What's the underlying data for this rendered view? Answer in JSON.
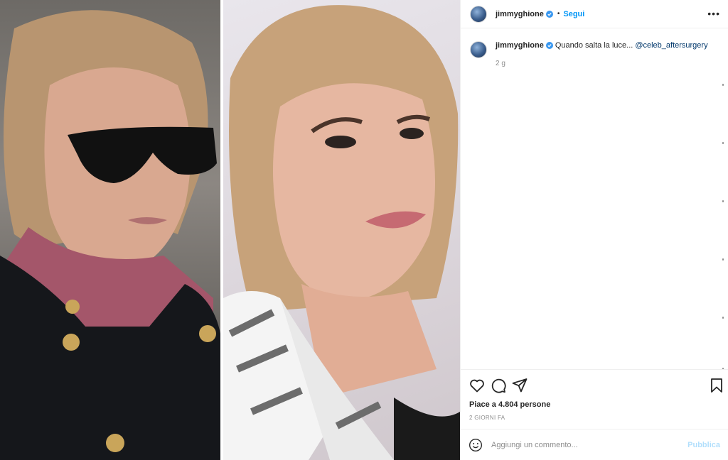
{
  "post": {
    "username": "jimmyghione",
    "follow_label": "Segui",
    "more_label": "•••",
    "separator": "•"
  },
  "caption": {
    "username": "jimmyghione",
    "text": "Quando salta la luce...",
    "mention": "@celeb_aftersurgery",
    "time_ago": "2 g"
  },
  "actions": {
    "likes": "Piace a 4.804 persone",
    "date": "2 GIORNI FA"
  },
  "comment": {
    "placeholder": "Aggiungi un commento...",
    "publish_label": "Pubblica"
  },
  "colors": {
    "accent": "#0095f6",
    "mention": "#00376b",
    "muted": "#8e8e8e",
    "publish_disabled": "#b2dffc",
    "border": "#efefef"
  },
  "icons": [
    "verified-icon",
    "more-options-icon",
    "heart-icon",
    "comment-icon",
    "share-icon",
    "bookmark-icon",
    "emoji-icon"
  ]
}
